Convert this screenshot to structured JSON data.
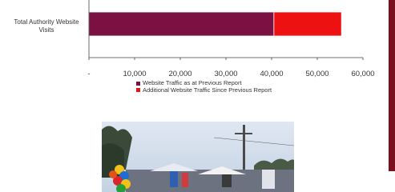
{
  "chart_data": {
    "type": "bar",
    "orientation": "horizontal",
    "stacked": true,
    "categories": [
      "Total Authority Website Visits"
    ],
    "series": [
      {
        "name": "Website Traffic as at Previous Report",
        "values": [
          40500
        ],
        "color": "#7b1142"
      },
      {
        "name": "Additional Website Traffic Since Previous Report",
        "values": [
          14800
        ],
        "color": "#ee1111"
      }
    ],
    "xlim": [
      0,
      60000
    ],
    "xticks": [
      0,
      10000,
      20000,
      30000,
      40000,
      50000,
      60000
    ],
    "xtick_labels": [
      "-",
      "10,000",
      "20,000",
      "30,000",
      "40,000",
      "50,000",
      "60,000"
    ],
    "legend_position": "bottom",
    "grid": false
  },
  "category_label": "Total Authority Website Visits",
  "legend": {
    "series1": "Website Traffic as at Previous Report",
    "series2": "Additional Website Traffic Since Previous Report"
  },
  "colors": {
    "series1": "#7b1142",
    "series2": "#ee1111",
    "side_bar": "#7a0f1e"
  }
}
